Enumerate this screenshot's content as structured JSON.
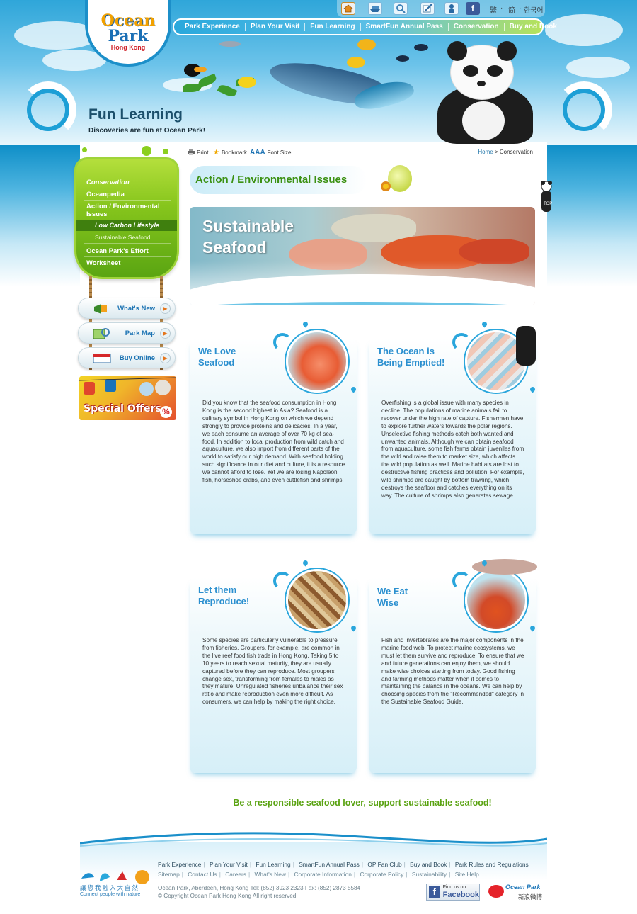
{
  "logo": {
    "line1": "Ocean",
    "line2": "Park",
    "line3": "Hong Kong"
  },
  "topbar": {
    "icons": [
      "home-icon",
      "ship-icon",
      "magnifier-icon",
      "pen-icon",
      "person-icon",
      "facebook-icon"
    ],
    "languages": [
      "繁",
      "简",
      "한국어"
    ]
  },
  "main_nav": [
    "Park Experience",
    "Plan Your Visit",
    "Fun Learning",
    "SmartFun Annual Pass",
    "Conservation",
    "Buy and Book"
  ],
  "header": {
    "title": "Fun Learning",
    "subtitle": "Discoveries are fun at Ocean Park!"
  },
  "sidebar": {
    "items": [
      {
        "label": "Conservation"
      },
      {
        "label": "Oceanpedia"
      },
      {
        "label": "Action / Environmental Issues"
      },
      {
        "label": "Low Carbon Lifestyle"
      },
      {
        "label": "Sustainable Seafood"
      },
      {
        "label": "Ocean Park's Effort"
      },
      {
        "label": "Worksheet"
      }
    ],
    "quick_links": [
      "What's New",
      "Park Map",
      "Buy Online"
    ],
    "special_offers": "Special Offers",
    "percent": "%"
  },
  "toolbar": {
    "print": "Print",
    "bookmark": "Bookmark",
    "aaa": "AAA",
    "font_size": "Font Size"
  },
  "breadcrumb": {
    "home": "Home",
    "separator": ">",
    "current": "Conservation"
  },
  "section_heading": "Action / Environmental Issues",
  "hero": {
    "title": "Sustainable\nSeafood"
  },
  "cards": [
    {
      "title": "We Love\nSeafood",
      "body": "Did you know that the seafood consumption in Hong Kong is the second highest in Asia? Seafood is a culinary symbol in Hong Kong on which we depend strongly to provide proteins and delicacies. In a year, we each consume an average of over 70 kg of sea-food. In addition to local production from wild catch and aquaculture, we also import from different parts of the world to satisfy our high demand. With seafood holding such significance in our diet and culture, it is a resource we cannot afford to lose. Yet we are losing Napoleon fish, horseshoe crabs, and even cuttlefish and shrimps!"
    },
    {
      "title": "The Ocean is\nBeing Emptied!",
      "body": "Overfishing is a global issue with many species in decline. The populations of marine animals fail to recover under the high rate of capture. Fishermen have to explore further waters towards the polar regions. Unselective fishing methods catch both wanted and unwanted animals. Although we can obtain seafood from aquaculture, some fish farms obtain juveniles from the wild and raise them to market size, which affects the wild population as well. Marine habitats are lost to destructive fishing practices and pollution. For example, wild shrimps are caught by bottom trawling, which destroys the seafloor and catches everything on its way. The culture of shrimps also generates sewage."
    },
    {
      "title": "Let them\nReproduce!",
      "body": "Some species are particularly vulnerable to pressure from fisheries. Groupers, for example, are common in the live reef food fish trade in Hong Kong. Taking 5 to 10 years to reach sexual maturity, they are usually captured before they can reproduce. Most groupers change sex, transforming from females to males as they mature. Unregulated fisheries unbalance their sex ratio and make reproduction even more difficult. As consumers, we can help by making the right choice."
    },
    {
      "title": "We Eat\nWise",
      "body": "Fish and invertebrates are the major components in the marine food web. To protect marine ecosystems, we must let them survive and reproduce. To ensure that we and future generations can enjoy them, we should make wise choices starting from today. Good fishing and farming methods matter when it comes to maintaining the balance in the oceans. We can help by choosing species from the \"Recommended\" category in the Sustainable Seafood Guide."
    }
  ],
  "slogan": "Be a responsible seafood lover, support sustainable seafood!",
  "footer": {
    "links_primary": [
      "Park Experience",
      "Plan Your Visit",
      "Fun Learning",
      "SmartFun Annual Pass",
      "OP Fan Club",
      "Buy and Book",
      "Park Rules and Regulations"
    ],
    "links_secondary": [
      "Sitemap",
      "Contact Us",
      "Careers",
      "What's New",
      "Corporate Information",
      "Corporate Policy",
      "Sustainability",
      "Site Help"
    ],
    "address": "Ocean Park, Aberdeen, Hong Kong Tel: (852) 3923 2323 Fax: (852) 2873 5584",
    "copyright": "© Copyright Ocean Park Hong Kong All right reserved.",
    "connect_zh": "讓您我融入大自然",
    "connect_en": "Connect people with nature",
    "facebook_line1": "Find us on",
    "facebook_line2": "Facebook",
    "weibo_name": "Ocean Park",
    "weibo_sub": "新浪微博"
  },
  "colors": {
    "brand_blue": "#2a8fcf",
    "nav_green": "#86c51c",
    "slogan_green": "#5aa312",
    "heading_green": "#3c9113"
  }
}
